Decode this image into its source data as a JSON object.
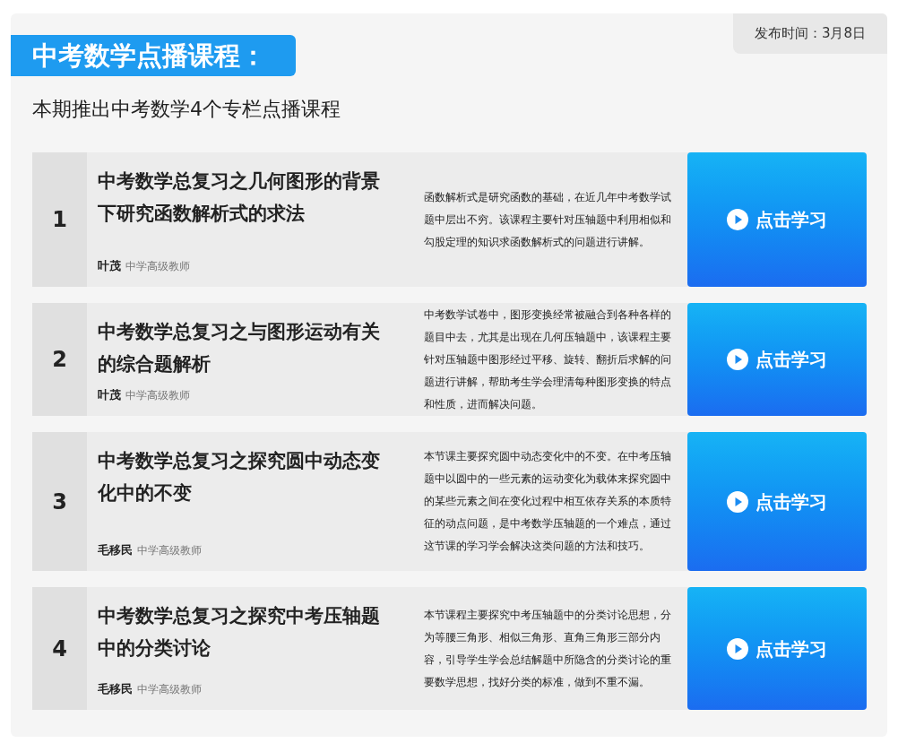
{
  "publish_date": "发布时间：3月8日",
  "title": "中考数学点播课程：",
  "subtitle": "本期推出中考数学4个专栏点播课程",
  "courses": [
    {
      "number": "1",
      "title": "中考数学总复习之几何图形的背景下研究函数解析式的求法",
      "teacher": "叶茂",
      "rank": "中学高级教师",
      "description": "函数解析式是研究函数的基础，在近几年中考数学试题中层出不穷。该课程主要针对压轴题中利用相似和勾股定理的知识求函数解析式的问题进行讲解。",
      "button": "点击学习"
    },
    {
      "number": "2",
      "title": "中考数学总复习之与图形运动有关的综合题解析",
      "teacher": "叶茂",
      "rank": "中学高级教师",
      "description": "中考数学试卷中，图形变换经常被融合到各种各样的题目中去，尤其是出现在几何压轴题中，该课程主要针对压轴题中图形经过平移、旋转、翻折后求解的问题进行讲解，帮助考生学会理清每种图形变换的特点和性质，进而解决问题。",
      "button": "点击学习"
    },
    {
      "number": "3",
      "title": "中考数学总复习之探究圆中动态变化中的不变",
      "teacher": "毛移民",
      "rank": "中学高级教师",
      "description": "本节课主要探究圆中动态变化中的不变。在中考压轴题中以圆中的一些元素的运动变化为载体来探究圆中的某些元素之间在变化过程中相互依存关系的本质特征的动点问题，是中考数学压轴题的一个难点，通过这节课的学习学会解决这类问题的方法和技巧。",
      "button": "点击学习"
    },
    {
      "number": "4",
      "title": "中考数学总复习之探究中考压轴题中的分类讨论",
      "teacher": "毛移民",
      "rank": "中学高级教师",
      "description": "本节课程主要探究中考压轴题中的分类讨论思想，分为等腰三角形、相似三角形、直角三角形三部分内容，引导学生学会总结解题中所隐含的分类讨论的重要数学思想，找好分类的标准，做到不重不漏。",
      "button": "点击学习"
    }
  ]
}
